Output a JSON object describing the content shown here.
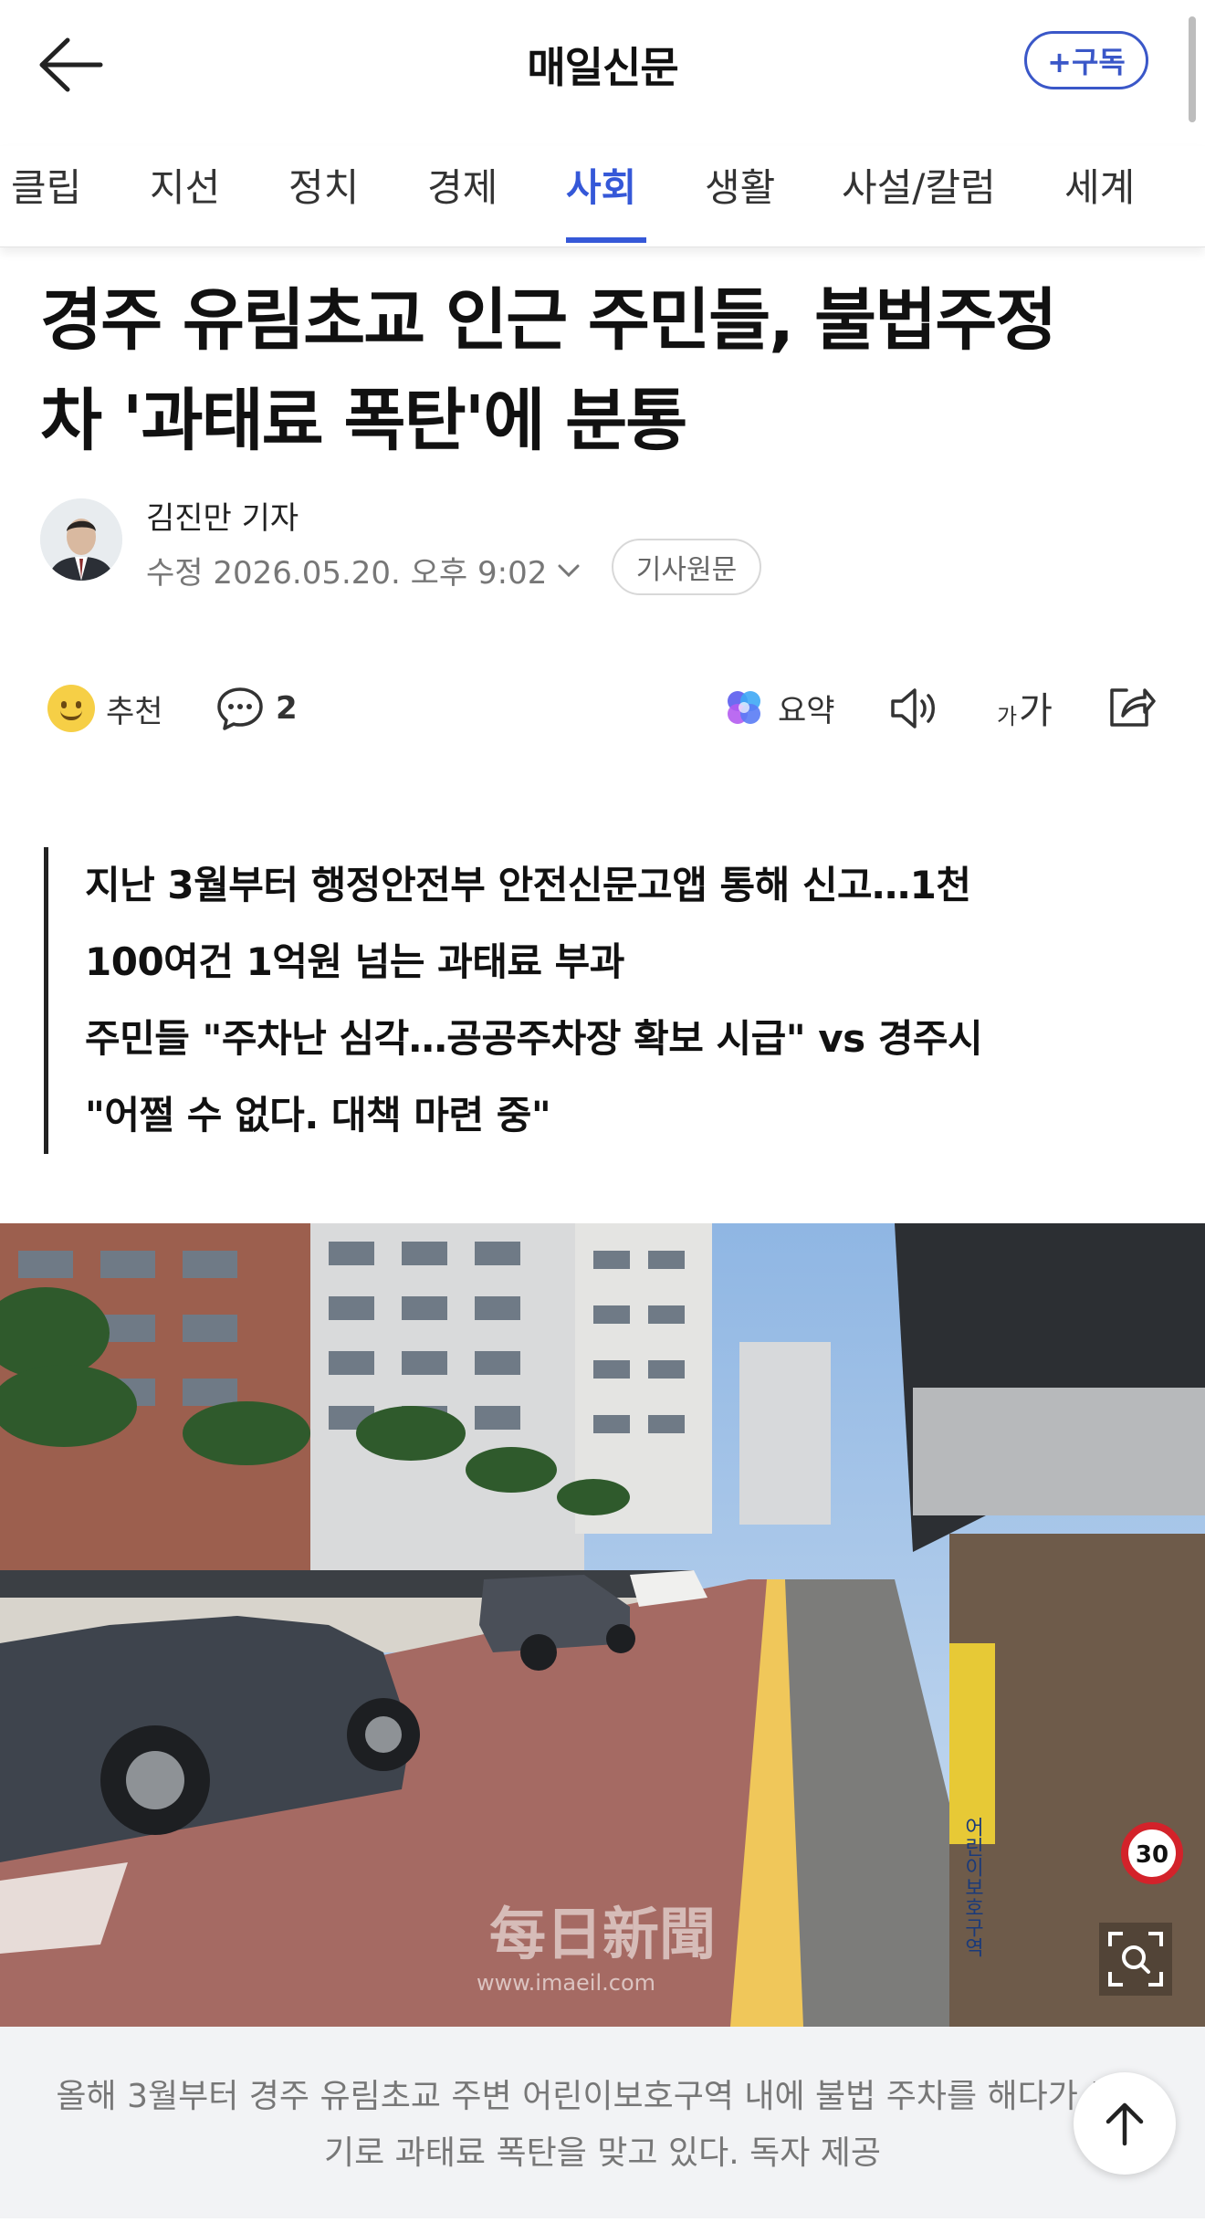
{
  "header": {
    "press_name": "매일신문",
    "subscribe_label": "+구독"
  },
  "tabs": [
    {
      "label": "클립"
    },
    {
      "label": "지선"
    },
    {
      "label": "정치"
    },
    {
      "label": "경제"
    },
    {
      "label": "사회",
      "active": true
    },
    {
      "label": "생활"
    },
    {
      "label": "사설/칼럼"
    },
    {
      "label": "세계"
    }
  ],
  "article": {
    "headline_line1": "경주 유림초교 인근 주민들, 불법주정",
    "headline_line2": "차 '과태료 폭탄'에 분통",
    "reporter": "김진만 기자",
    "updated": "수정 2026.05.20. 오후 9:02",
    "original_label": "기사원문",
    "summary": [
      "지난 3월부터 행정안전부 안전신문고앱 통해 신고…1천",
      "100여건 1억원 넘는 과태료 부과",
      "주민들 \"주차난 심각…공공주차장 확보 시급\" vs 경주시",
      "\"어쩔 수 없다. 대책 마련 중\""
    ],
    "caption": "올해 3월부터 경주 유림초교 주변 어린이보호구역 내에 불법 주차를 해다가 무더기로 과태료 폭탄을 맞고 있다. 독자 제공",
    "watermark_main": "每日新聞",
    "watermark_url": "www.imaeil.com",
    "sign_text": "어린이보호구역",
    "speed_limit": "30"
  },
  "actions": {
    "recommend_label": "추천",
    "comment_count": "2",
    "summary_label": "요약",
    "font_label_small": "가",
    "font_label_big": "가"
  },
  "icons": [
    "back-arrow-icon",
    "smile-emoji-icon",
    "comment-icon",
    "ai-summary-icon",
    "speaker-icon",
    "font-size-icon",
    "share-icon",
    "zoom-icon",
    "arrow-up-icon"
  ],
  "colors": {
    "accent": "#3558d8",
    "subscribe": "#3a57c8",
    "caption_bg": "#f2f3f5"
  }
}
